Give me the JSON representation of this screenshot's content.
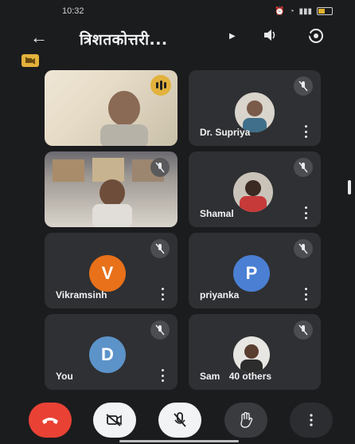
{
  "status_bar": {
    "time": "10:32",
    "icons": [
      "alarm",
      "wifi",
      "signal",
      "battery"
    ]
  },
  "header": {
    "title": "त्रिशतकोत्तरी...",
    "back_icon": "arrow-left-icon",
    "cast_icon": "cast-icon",
    "speaker_icon": "speaker-icon",
    "switch_camera_icon": "switch-camera-icon"
  },
  "participants": [
    {
      "name": "",
      "type": "video",
      "speaking": true
    },
    {
      "name": "Dr. Supriya",
      "type": "photo",
      "muted": true
    },
    {
      "name": "",
      "type": "video",
      "muted": true
    },
    {
      "name": "Shamal",
      "type": "photo",
      "muted": true
    },
    {
      "name": "Vikramsinh",
      "type": "initial",
      "initial": "V",
      "color": "#e8711a",
      "muted": true
    },
    {
      "name": "priyanka",
      "type": "initial",
      "initial": "P",
      "color": "#4a7fd4",
      "muted": true
    },
    {
      "name": "You",
      "type": "initial",
      "initial": "D",
      "color": "#5c93c9",
      "muted": true
    },
    {
      "name": "Sam",
      "others_label": "40 others",
      "type": "photo",
      "muted": true
    }
  ],
  "controls": [
    {
      "name": "end-call-button",
      "icon": "phone-hangup-icon",
      "color": "#e94235"
    },
    {
      "name": "camera-toggle-button",
      "icon": "camera-off-icon",
      "color": "#f1f3f4"
    },
    {
      "name": "mic-toggle-button",
      "icon": "mic-off-icon",
      "color": "#f1f3f4"
    },
    {
      "name": "raise-hand-button",
      "icon": "hand-icon",
      "color": "#3a3b3e"
    },
    {
      "name": "more-options-button",
      "icon": "more-vert-icon",
      "color": "#3a3b3e"
    }
  ]
}
